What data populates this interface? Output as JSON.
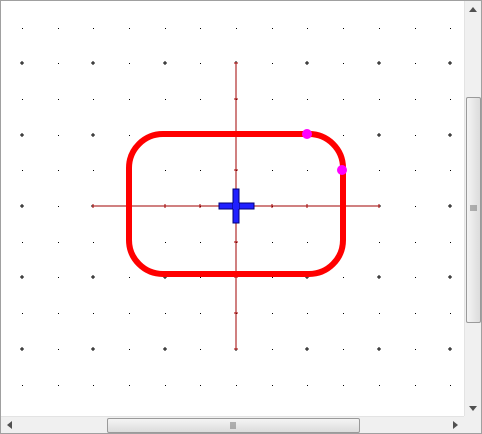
{
  "canvas": {
    "background_color": "#ffffff",
    "grid_dot_color": "#000000",
    "axis_color": "#a00000",
    "shape_stroke_color": "#ff0000",
    "handle_color": "#ff00ff",
    "origin_marker_color": "#0000cc",
    "shape": "rounded-rectangle",
    "origin_marker_icon": "plus-cross-icon",
    "selection_handles": 2
  },
  "scrollbars": {
    "vertical": {
      "up_icon": "arrow-up-icon",
      "down_icon": "arrow-down-icon",
      "grip_icon": "grip-lines-icon"
    },
    "horizontal": {
      "left_icon": "arrow-left-icon",
      "right_icon": "arrow-right-icon",
      "grip_icon": "grip-lines-icon"
    }
  }
}
